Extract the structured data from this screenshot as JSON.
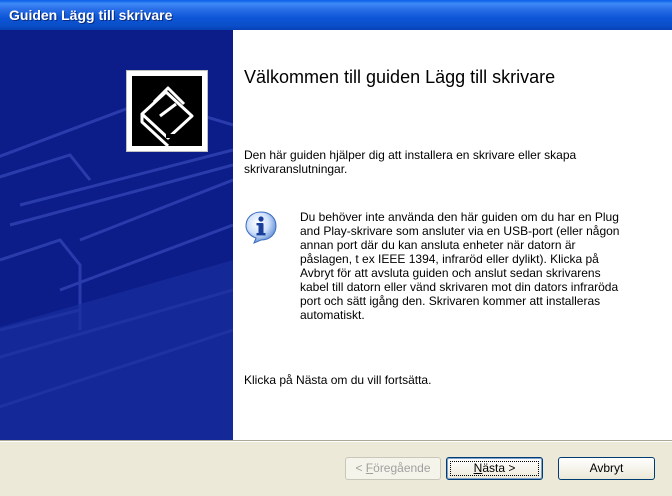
{
  "window": {
    "title": "Guiden Lägg till skrivare"
  },
  "banner": {
    "icon": "printer-wizard-icon",
    "background_color": "#0c1d8a"
  },
  "content": {
    "heading": "Välkommen till guiden Lägg till skrivare",
    "intro": "Den här guiden hjälper dig att installera en skrivare eller skapa skrivaranslutningar.",
    "info_icon": "info-icon",
    "info_text": "Du behöver inte använda den här guiden om du har en Plug and Play-skrivare som ansluter via en USB-port (eller någon annan port där du kan ansluta enheter när datorn är påslagen, t ex IEEE 1394, infraröd eller dylikt). Klicka på Avbryt för att avsluta guiden och anslut sedan skrivarens kabel till datorn eller vänd skrivaren mot din dators infraröda port och sätt igång den. Skrivaren kommer att installeras automatiskt.",
    "continue_text": "Klicka på Nästa om du vill fortsätta."
  },
  "buttons": {
    "back": {
      "prefix": "< ",
      "accel": "F",
      "rest": "öregående",
      "enabled": false
    },
    "next": {
      "accel": "N",
      "rest": "ästa >",
      "enabled": true
    },
    "cancel": {
      "label": "Avbryt",
      "enabled": true
    }
  }
}
